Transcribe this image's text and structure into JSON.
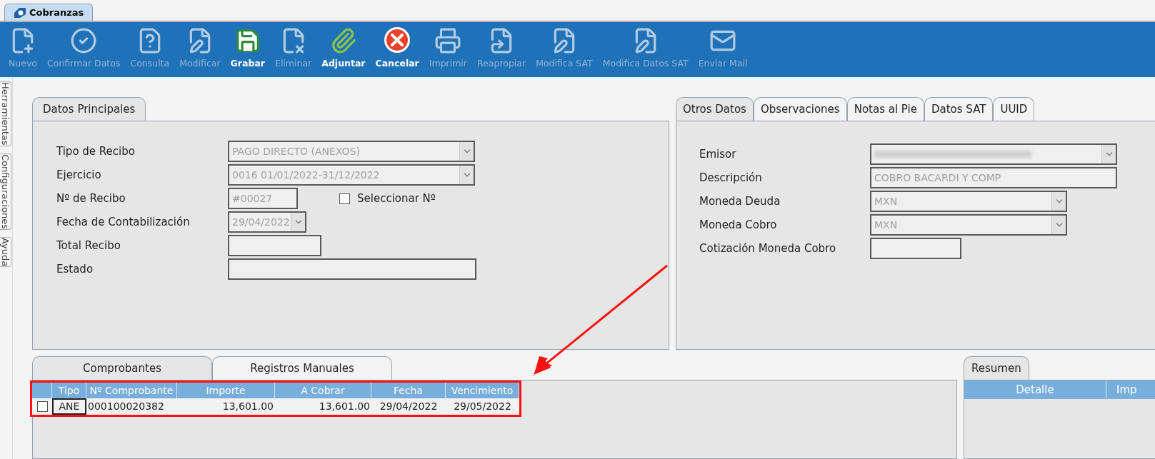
{
  "app_tab": {
    "label": "Cobranzas",
    "selected": true
  },
  "toolbar": [
    {
      "label": "Nuevo",
      "disabled": true
    },
    {
      "label": "Confirmar Datos",
      "disabled": true
    },
    {
      "label": "Consulta",
      "disabled": true
    },
    {
      "label": "Modificar",
      "disabled": true
    },
    {
      "label": "Grabar",
      "disabled": false
    },
    {
      "label": "Eliminar",
      "disabled": true
    },
    {
      "label": "Adjuntar",
      "disabled": false
    },
    {
      "label": "Cancelar",
      "disabled": false
    },
    {
      "label": "Imprimir",
      "disabled": true
    },
    {
      "label": "Reapropiar",
      "disabled": true
    },
    {
      "label": "Modifica SAT",
      "disabled": true
    },
    {
      "label": "Modifica Datos SAT",
      "disabled": true
    },
    {
      "label": "Enviar Mail",
      "disabled": true
    }
  ],
  "side_tabs": [
    "Herramientas",
    "Configuraciones",
    "Ayuda"
  ],
  "main_panel": {
    "tabs": [
      {
        "label": "Datos Principales",
        "selected": true
      }
    ],
    "fields": [
      {
        "label": "Tipo de Recibo",
        "kind": "dropdown",
        "value": "PAGO DIRECTO (ANEXOS)"
      },
      {
        "label": "Ejercicio",
        "kind": "dropdown",
        "value": "0016 01/01/2022-31/12/2022"
      },
      {
        "label": "Nº de Recibo",
        "kind": "text",
        "value": "#00027",
        "checkbox": {
          "label": "Seleccionar Nº",
          "checked": false
        }
      },
      {
        "label": "Fecha de Contabilización",
        "kind": "dropdown",
        "value": "29/04/2022"
      },
      {
        "label": "Total Recibo",
        "kind": "text"
      },
      {
        "label": "Estado",
        "kind": "text"
      }
    ]
  },
  "other_panel": {
    "tabs": [
      {
        "label": "Otros Datos",
        "selected": true
      },
      {
        "label": "Observaciones",
        "selected": false
      },
      {
        "label": "Notas al Pie",
        "selected": false
      },
      {
        "label": "Datos SAT",
        "selected": false
      },
      {
        "label": "UUID",
        "selected": false
      }
    ],
    "fields": [
      {
        "label": "Emisor",
        "kind": "dropdown",
        "blurred": true
      },
      {
        "label": "Descripción",
        "kind": "text",
        "value": "COBRO BACARDI Y COMP"
      },
      {
        "label": "Moneda Deuda",
        "kind": "dropdown",
        "value": "MXN"
      },
      {
        "label": "Moneda Cobro",
        "kind": "dropdown",
        "value": "MXN"
      },
      {
        "label": "Cotización Moneda Cobro",
        "kind": "text"
      }
    ]
  },
  "documents": {
    "tabs": [
      {
        "label": "Comprobantes",
        "selected": true
      },
      {
        "label": "Registros Manuales",
        "selected": false
      }
    ],
    "table": {
      "columns": [
        "Tipo",
        "Nº Comprobante",
        "Importe",
        "A Cobrar",
        "Fecha",
        "Vencimiento"
      ],
      "rows": [
        {
          "checked": false,
          "cells": [
            "ANE",
            "000100020382",
            "13,601.00",
            "13,601.00",
            "29/04/2022",
            "29/05/2022"
          ]
        }
      ]
    }
  },
  "summary": {
    "tabs": [
      {
        "label": "Resumen",
        "selected": true
      }
    ],
    "columns": [
      "Detalle",
      "Imp"
    ]
  }
}
